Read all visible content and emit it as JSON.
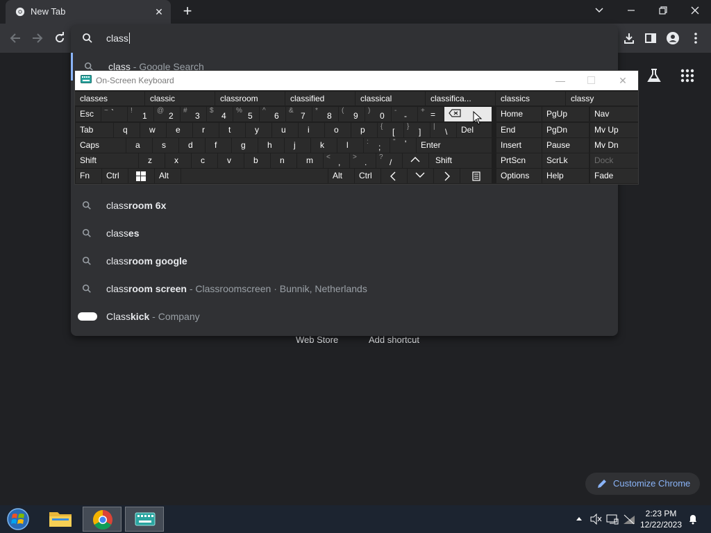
{
  "browser": {
    "tab_title": "New Tab",
    "new_tab_symbol": "+",
    "close_symbol": "✕"
  },
  "omnibox": {
    "typed_text": "class",
    "first_suggestion": {
      "bold": "class",
      "rest": " - Google Search"
    },
    "suggestions": [
      {
        "typed": "class",
        "completion": "room 6x",
        "detail": ""
      },
      {
        "typed": "class",
        "completion": "es",
        "detail": ""
      },
      {
        "typed": "class",
        "completion": "room google",
        "detail": ""
      },
      {
        "typed": "class",
        "completion": "room screen",
        "detail": " - Classroomscreen · Bunnik, Netherlands"
      },
      {
        "typed": "Class",
        "completion": "kick",
        "detail": " - Company"
      }
    ]
  },
  "ntp": {
    "shortcut_web_store": "Web Store",
    "shortcut_add": "Add shortcut",
    "customize_label": "Customize Chrome"
  },
  "osk": {
    "title": "On-Screen Keyboard",
    "predictions": [
      "classes",
      "classic",
      "classroom",
      "classified",
      "classical",
      "classifica...",
      "classics",
      "classy"
    ],
    "keys": {
      "esc": "Esc",
      "tab": "Tab",
      "caps": "Caps",
      "shift": "Shift",
      "fn": "Fn",
      "ctrl": "Ctrl",
      "alt": "Alt",
      "del": "Del",
      "enter": "Enter",
      "home": "Home",
      "pgup": "PgUp",
      "nav": "Nav",
      "end": "End",
      "pgdn": "PgDn",
      "mvup": "Mv Up",
      "insert": "Insert",
      "pause": "Pause",
      "mvdn": "Mv Dn",
      "prtscn": "PrtScn",
      "scrlk": "ScrLk",
      "dock": "Dock",
      "options": "Options",
      "help": "Help",
      "fade": "Fade",
      "row1": [
        [
          "~",
          "`"
        ],
        [
          "!",
          "1"
        ],
        [
          "@",
          "2"
        ],
        [
          "#",
          "3"
        ],
        [
          "$",
          "4"
        ],
        [
          "%",
          "5"
        ],
        [
          "^",
          "6"
        ],
        [
          "&",
          "7"
        ],
        [
          "*",
          "8"
        ],
        [
          "(",
          "9"
        ],
        [
          ")",
          "0"
        ],
        [
          "-",
          "-"
        ],
        [
          "+",
          "="
        ]
      ],
      "row2": [
        "q",
        "w",
        "e",
        "r",
        "t",
        "y",
        "u",
        "i",
        "o",
        "p"
      ],
      "row2_sym": [
        [
          "{",
          "["
        ],
        [
          "}",
          "]"
        ],
        [
          "|",
          "\\"
        ]
      ],
      "row3": [
        "a",
        "s",
        "d",
        "f",
        "g",
        "h",
        "j",
        "k",
        "l"
      ],
      "row3_sym": [
        [
          ":",
          ";"
        ],
        [
          "\"",
          "'"
        ]
      ],
      "row4": [
        "z",
        "x",
        "c",
        "v",
        "b",
        "n",
        "m"
      ],
      "row4_sym": [
        [
          "<",
          ","
        ],
        [
          ">",
          "."
        ],
        [
          "?",
          "/"
        ]
      ]
    }
  },
  "taskbar": {
    "time": "2:23 PM",
    "date": "12/22/2023"
  }
}
